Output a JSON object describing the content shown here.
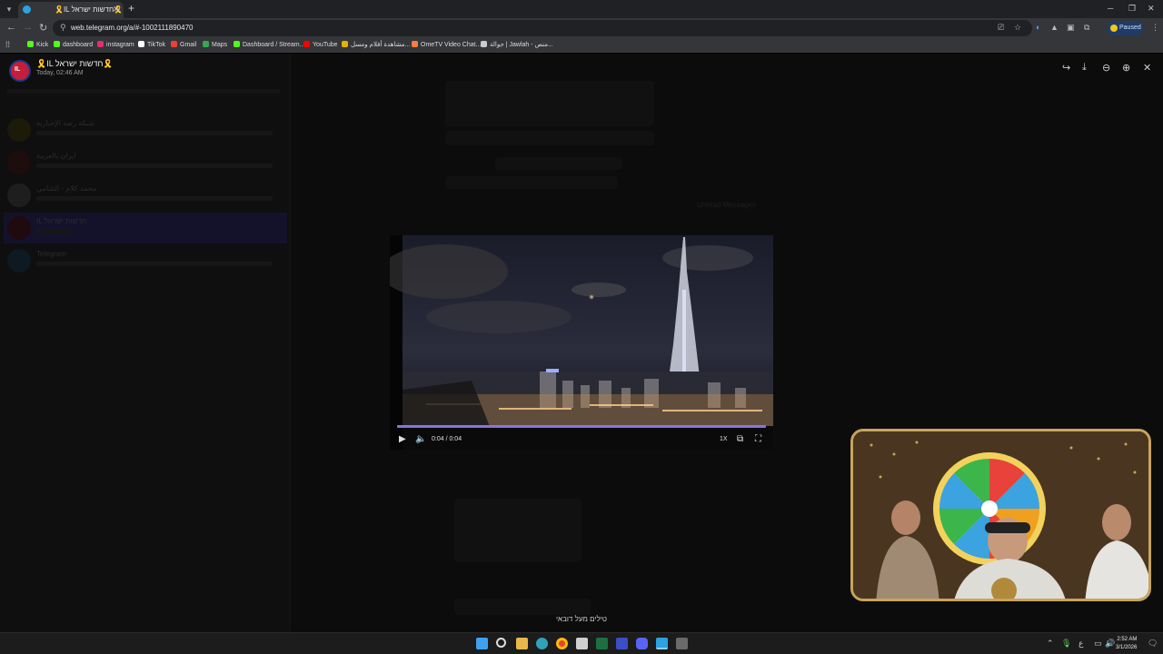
{
  "browser": {
    "tab_title": "🎗️IL חדשות ישראל🎗️",
    "url": "web.telegram.org/a/#-1002111890470",
    "extension_status": "Paused",
    "bookmarks": [
      {
        "label": "Kick",
        "color": "#53fc18"
      },
      {
        "label": "dashboard",
        "color": "#53fc18"
      },
      {
        "label": "instagram",
        "color": "#e1306c"
      },
      {
        "label": "TikTok",
        "color": "#ffffff"
      },
      {
        "label": "Gmail",
        "color": "#ea4335"
      },
      {
        "label": "Maps",
        "color": "#34a853"
      },
      {
        "label": "Dashboard / Stream...",
        "color": "#53fc18"
      },
      {
        "label": "YouTube",
        "color": "#ff0000"
      },
      {
        "label": "مشاهدة أفلام ومسل...",
        "color": "#e5b100"
      },
      {
        "label": "OmeTV Video Chat...",
        "color": "#ff7a3d"
      },
      {
        "label": "جوالة | Jawlah - منص...",
        "color": "#cccccc"
      }
    ]
  },
  "viewer": {
    "channel_title": "🎗️IL חדשות ישראל🎗️",
    "date": "Today, 02:46 AM",
    "avatar_text": "IL",
    "caption": "טילים מעל דובאי"
  },
  "video": {
    "current_time": "0:04 / 0:04",
    "speed": "1X",
    "progress": 1.0,
    "accent_color": "#8774e1"
  },
  "background": {
    "chat_names": [
      "شبكة رصد الإخبارية",
      "ايران بالعربية",
      "محمد كلام - الشامي",
      "IL חדשות ישראל",
      "Telegram"
    ],
    "unread_label": "Unread Messages"
  },
  "taskbar": {
    "time": "2:52 AM",
    "date": "3/1/2026",
    "lang": "ع"
  }
}
